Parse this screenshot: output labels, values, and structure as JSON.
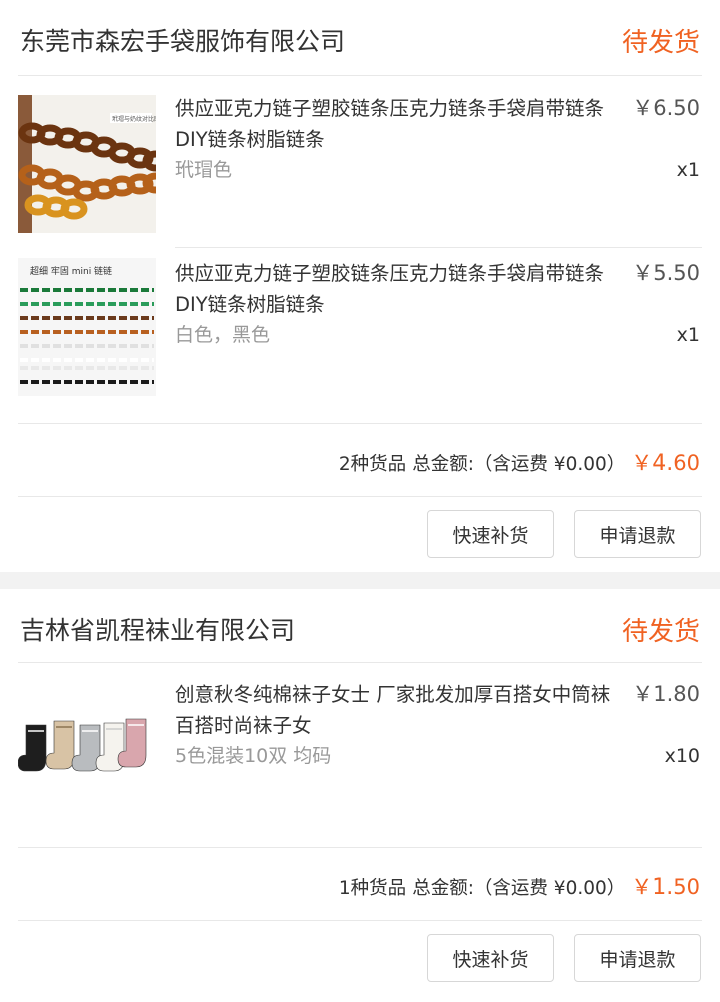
{
  "orders": [
    {
      "shop_name": "东莞市森宏手袋服饰有限公司",
      "status": "待发货",
      "items": [
        {
          "title": "供应亚克力链子塑胶链条压克力链条手袋肩带链条DIY链条树脂链条",
          "price": "￥6.50",
          "spec": "玳瑁色",
          "qty": "x1",
          "thumb_caption": "玳瑁与奶纹对比图"
        },
        {
          "title": "供应亚克力链子塑胶链条压克力链条手袋肩带链条DIY链条树脂链条",
          "price": "￥5.50",
          "spec": "白色，黑色",
          "qty": "x1",
          "thumb_caption": "超细 牢固 mini 链链"
        }
      ],
      "summary": {
        "count_text": "2种货品",
        "total_label": "总金额:（含运费 ¥0.00）",
        "total_currency": "￥",
        "total_int": "4.",
        "total_dec": "60"
      },
      "buttons": {
        "restock": "快速补货",
        "refund": "申请退款"
      }
    },
    {
      "shop_name": "吉林省凯程袜业有限公司",
      "status": "待发货",
      "items": [
        {
          "title": "创意秋冬纯棉袜子女士 厂家批发加厚百搭女中筒袜 百搭时尚袜子女",
          "price": "￥1.80",
          "spec": "5色混装10双 均码",
          "qty": "x10"
        }
      ],
      "summary": {
        "count_text": "1种货品",
        "total_label": "总金额:（含运费 ¥0.00）",
        "total_currency": "￥",
        "total_int": "1.",
        "total_dec": "50"
      },
      "buttons": {
        "restock": "快速补货",
        "refund": "申请退款"
      }
    }
  ],
  "colors": {
    "accent": "#f06222",
    "text": "#333333",
    "muted": "#999999",
    "border": "#e8e8e8",
    "background": "#f2f2f2"
  }
}
